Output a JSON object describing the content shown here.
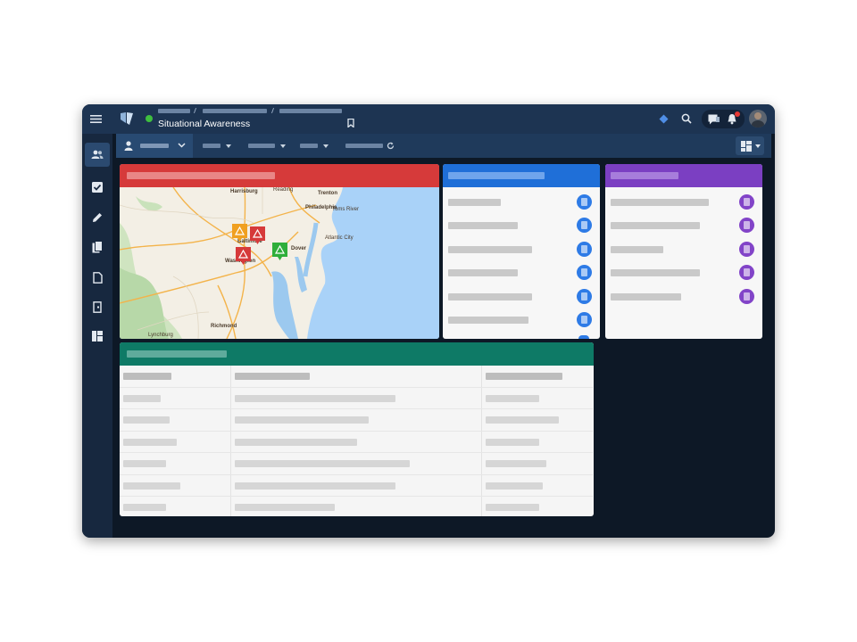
{
  "app": {
    "title": "Situational Awareness",
    "status_color": "#3fbf3f",
    "accent": "#1d3452"
  },
  "header_icons": [
    "menu-icon",
    "logo-icon",
    "bookmark-icon",
    "diamond-icon",
    "search-icon",
    "messages-icon",
    "bell-icon",
    "avatar"
  ],
  "sidebar_icons": [
    "users-icon",
    "checkbox-icon",
    "pencil-icon",
    "documents-icon",
    "file-icon",
    "exit-icon",
    "layout-icon"
  ],
  "panels": {
    "map": {
      "header_color": "#d63a3a"
    },
    "list_blue": {
      "header_color": "#1f6fd8",
      "accent": "#2e7be6"
    },
    "list_purple": {
      "header_color": "#7b3fc2",
      "accent": "#8244c8"
    },
    "table": {
      "header_color": "#0e7a66"
    }
  },
  "map": {
    "labels": [
      "Harrisburg",
      "Reading",
      "Trenton",
      "Philadelphia",
      "Toms River",
      "Baltimore",
      "Dover",
      "Atlantic City",
      "Washington",
      "Richmond",
      "Lynchburg"
    ],
    "markers": [
      {
        "color": "#f0a020",
        "icon": "warning-icon"
      },
      {
        "color": "#d63a3a",
        "icon": "warning-icon"
      },
      {
        "color": "#d63a3a",
        "icon": "warning-icon"
      },
      {
        "color": "#2fae3a",
        "icon": "warning-icon"
      }
    ]
  }
}
